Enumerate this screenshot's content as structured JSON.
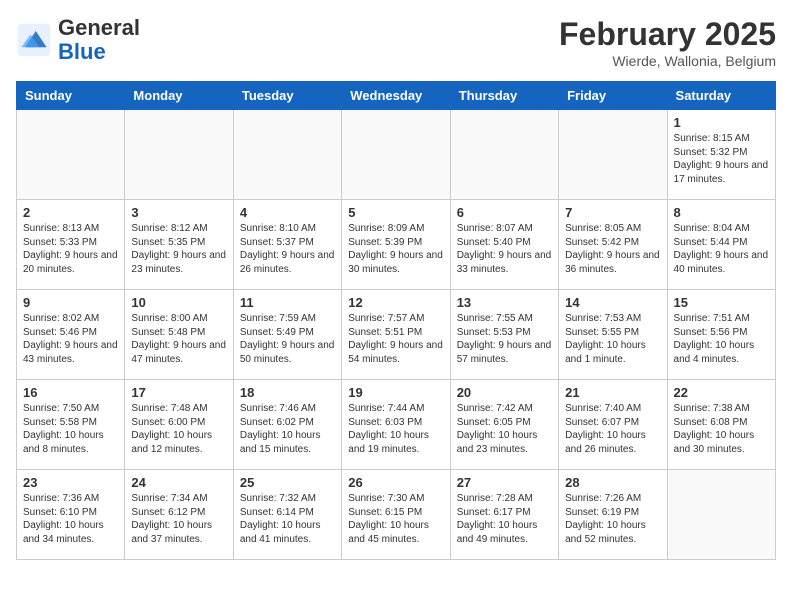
{
  "header": {
    "logo_general": "General",
    "logo_blue": "Blue",
    "title": "February 2025",
    "location": "Wierde, Wallonia, Belgium"
  },
  "days_of_week": [
    "Sunday",
    "Monday",
    "Tuesday",
    "Wednesday",
    "Thursday",
    "Friday",
    "Saturday"
  ],
  "weeks": [
    [
      {
        "day": "",
        "info": ""
      },
      {
        "day": "",
        "info": ""
      },
      {
        "day": "",
        "info": ""
      },
      {
        "day": "",
        "info": ""
      },
      {
        "day": "",
        "info": ""
      },
      {
        "day": "",
        "info": ""
      },
      {
        "day": "1",
        "info": "Sunrise: 8:15 AM\nSunset: 5:32 PM\nDaylight: 9 hours and 17 minutes."
      }
    ],
    [
      {
        "day": "2",
        "info": "Sunrise: 8:13 AM\nSunset: 5:33 PM\nDaylight: 9 hours and 20 minutes."
      },
      {
        "day": "3",
        "info": "Sunrise: 8:12 AM\nSunset: 5:35 PM\nDaylight: 9 hours and 23 minutes."
      },
      {
        "day": "4",
        "info": "Sunrise: 8:10 AM\nSunset: 5:37 PM\nDaylight: 9 hours and 26 minutes."
      },
      {
        "day": "5",
        "info": "Sunrise: 8:09 AM\nSunset: 5:39 PM\nDaylight: 9 hours and 30 minutes."
      },
      {
        "day": "6",
        "info": "Sunrise: 8:07 AM\nSunset: 5:40 PM\nDaylight: 9 hours and 33 minutes."
      },
      {
        "day": "7",
        "info": "Sunrise: 8:05 AM\nSunset: 5:42 PM\nDaylight: 9 hours and 36 minutes."
      },
      {
        "day": "8",
        "info": "Sunrise: 8:04 AM\nSunset: 5:44 PM\nDaylight: 9 hours and 40 minutes."
      }
    ],
    [
      {
        "day": "9",
        "info": "Sunrise: 8:02 AM\nSunset: 5:46 PM\nDaylight: 9 hours and 43 minutes."
      },
      {
        "day": "10",
        "info": "Sunrise: 8:00 AM\nSunset: 5:48 PM\nDaylight: 9 hours and 47 minutes."
      },
      {
        "day": "11",
        "info": "Sunrise: 7:59 AM\nSunset: 5:49 PM\nDaylight: 9 hours and 50 minutes."
      },
      {
        "day": "12",
        "info": "Sunrise: 7:57 AM\nSunset: 5:51 PM\nDaylight: 9 hours and 54 minutes."
      },
      {
        "day": "13",
        "info": "Sunrise: 7:55 AM\nSunset: 5:53 PM\nDaylight: 9 hours and 57 minutes."
      },
      {
        "day": "14",
        "info": "Sunrise: 7:53 AM\nSunset: 5:55 PM\nDaylight: 10 hours and 1 minute."
      },
      {
        "day": "15",
        "info": "Sunrise: 7:51 AM\nSunset: 5:56 PM\nDaylight: 10 hours and 4 minutes."
      }
    ],
    [
      {
        "day": "16",
        "info": "Sunrise: 7:50 AM\nSunset: 5:58 PM\nDaylight: 10 hours and 8 minutes."
      },
      {
        "day": "17",
        "info": "Sunrise: 7:48 AM\nSunset: 6:00 PM\nDaylight: 10 hours and 12 minutes."
      },
      {
        "day": "18",
        "info": "Sunrise: 7:46 AM\nSunset: 6:02 PM\nDaylight: 10 hours and 15 minutes."
      },
      {
        "day": "19",
        "info": "Sunrise: 7:44 AM\nSunset: 6:03 PM\nDaylight: 10 hours and 19 minutes."
      },
      {
        "day": "20",
        "info": "Sunrise: 7:42 AM\nSunset: 6:05 PM\nDaylight: 10 hours and 23 minutes."
      },
      {
        "day": "21",
        "info": "Sunrise: 7:40 AM\nSunset: 6:07 PM\nDaylight: 10 hours and 26 minutes."
      },
      {
        "day": "22",
        "info": "Sunrise: 7:38 AM\nSunset: 6:08 PM\nDaylight: 10 hours and 30 minutes."
      }
    ],
    [
      {
        "day": "23",
        "info": "Sunrise: 7:36 AM\nSunset: 6:10 PM\nDaylight: 10 hours and 34 minutes."
      },
      {
        "day": "24",
        "info": "Sunrise: 7:34 AM\nSunset: 6:12 PM\nDaylight: 10 hours and 37 minutes."
      },
      {
        "day": "25",
        "info": "Sunrise: 7:32 AM\nSunset: 6:14 PM\nDaylight: 10 hours and 41 minutes."
      },
      {
        "day": "26",
        "info": "Sunrise: 7:30 AM\nSunset: 6:15 PM\nDaylight: 10 hours and 45 minutes."
      },
      {
        "day": "27",
        "info": "Sunrise: 7:28 AM\nSunset: 6:17 PM\nDaylight: 10 hours and 49 minutes."
      },
      {
        "day": "28",
        "info": "Sunrise: 7:26 AM\nSunset: 6:19 PM\nDaylight: 10 hours and 52 minutes."
      },
      {
        "day": "",
        "info": ""
      }
    ]
  ]
}
